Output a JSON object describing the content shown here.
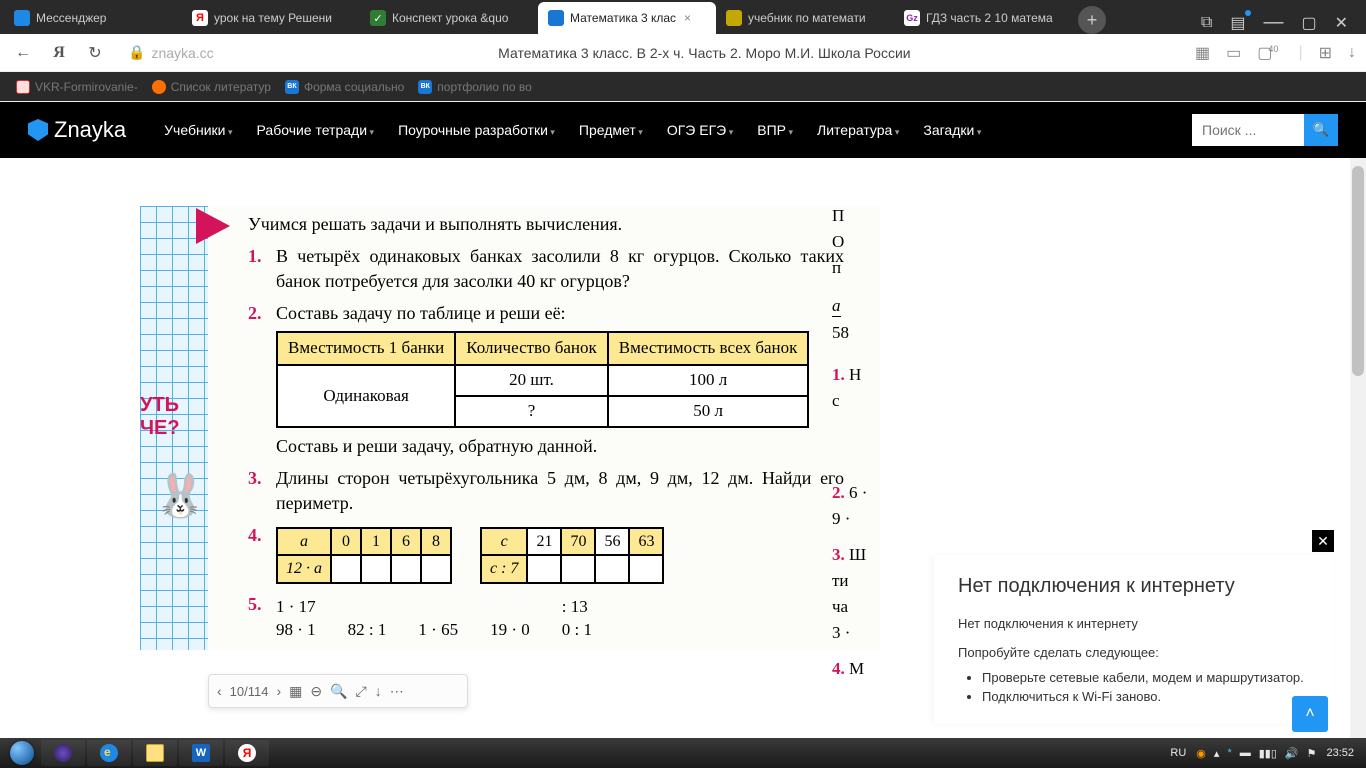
{
  "tabs": [
    {
      "label": "Мессенджер",
      "icon_color": "#1e88e5"
    },
    {
      "label": "урок на тему Решени",
      "icon_color": "#ffb300",
      "icon_char": "Я"
    },
    {
      "label": "Конспект урока &quo",
      "icon_color": "#2e7d32"
    },
    {
      "label": "Математика 3 клас",
      "icon_color": "#1976d2",
      "active": true
    },
    {
      "label": "учебник по математи",
      "icon_color": "#c2a800"
    },
    {
      "label": "ГДЗ часть 2 10 матема",
      "icon_color": "#8e24aa"
    }
  ],
  "addr": {
    "url": "znayka.cc",
    "page_title": "Математика 3 класс. В 2-х ч. Часть 2. Моро М.И. Школа России",
    "tab_count": "40"
  },
  "bookmarks": [
    {
      "label": "VKR-Formirovanie-",
      "color": "#d32f2f"
    },
    {
      "label": "Список литератур",
      "color": "#ff6f00"
    },
    {
      "label": "Форма социально",
      "color": "#1976d2",
      "char": "ВК"
    },
    {
      "label": "портфолио по во",
      "color": "#1976d2",
      "char": "ВК"
    }
  ],
  "site": {
    "logo": "Znayka",
    "menu": [
      "Учебники",
      "Рабочие тетради",
      "Поурочные разработки",
      "Предмет",
      "ОГЭ ЕГЭ",
      "ВПР",
      "Литература",
      "Загадки"
    ],
    "search_placeholder": "Поиск ..."
  },
  "book": {
    "side_text1": "УТЬ",
    "side_text2": "ЧЕ?",
    "heading": "Учимся решать задачи и выполнять вычисления.",
    "task1_num": "1.",
    "task1": "В четырёх одинаковых банках засолили 8 кг огурцов. Сколько таких банок потребуется для засолки 40 кг огурцов?",
    "task2_num": "2.",
    "task2": "Составь задачу по таблице и реши её:",
    "table": {
      "h1": "Вместимость 1 банки",
      "h2": "Количество банок",
      "h3": "Вместимость всех банок",
      "r_merge": "Одинаковая",
      "r1c2": "20 шт.",
      "r1c3": "100 л",
      "r2c2": "?",
      "r2c3": "50 л"
    },
    "task2_after": "Составь и реши задачу, обратную данной.",
    "task3_num": "3.",
    "task3": "Длины сторон четырёхугольника 5 дм, 8 дм, 9 дм, 12 дм. Найди его периметр.",
    "task4_num": "4.",
    "miniA": {
      "lbl1": "a",
      "lbl2": "12 · a",
      "v": [
        "0",
        "1",
        "6",
        "8"
      ]
    },
    "miniC": {
      "lbl1": "c",
      "lbl2": "c : 7",
      "v": [
        "21",
        "70",
        "56",
        "63"
      ]
    },
    "task5_num": "5.",
    "expr1": [
      "1 · 17",
      "98 · 1"
    ],
    "expr2": "82 : 1",
    "expr3": "1 · 65",
    "expr4": "19 · 0",
    "expr5": ": 13",
    "expr6": "0 : 1",
    "right_strip": {
      "r1": "П",
      "r2": "О",
      "r3": "п",
      "r4": "a",
      "r5": "58",
      "r6n": "1.",
      "r6": "Н",
      "r7": "с",
      "r8n": "2.",
      "r8a": "6 ·",
      "r8b": "9 ·",
      "r9n": "3.",
      "r9a": "Ш",
      "r9b": "ти",
      "r9c": "ча",
      "r9d": "3 ·",
      "r10n": "4.",
      "r10": "М"
    }
  },
  "viewer": {
    "page": "10/114"
  },
  "offline": {
    "title": "Нет подключения к интернету",
    "sub": "Нет подключения к интернету",
    "try": "Попробуйте сделать следующее:",
    "bullets": [
      "Проверьте сетевые кабели, модем и маршрутизатор.",
      "Подключиться к Wi-Fi заново."
    ]
  },
  "taskbar": {
    "lang": "RU",
    "time": "23:52"
  }
}
